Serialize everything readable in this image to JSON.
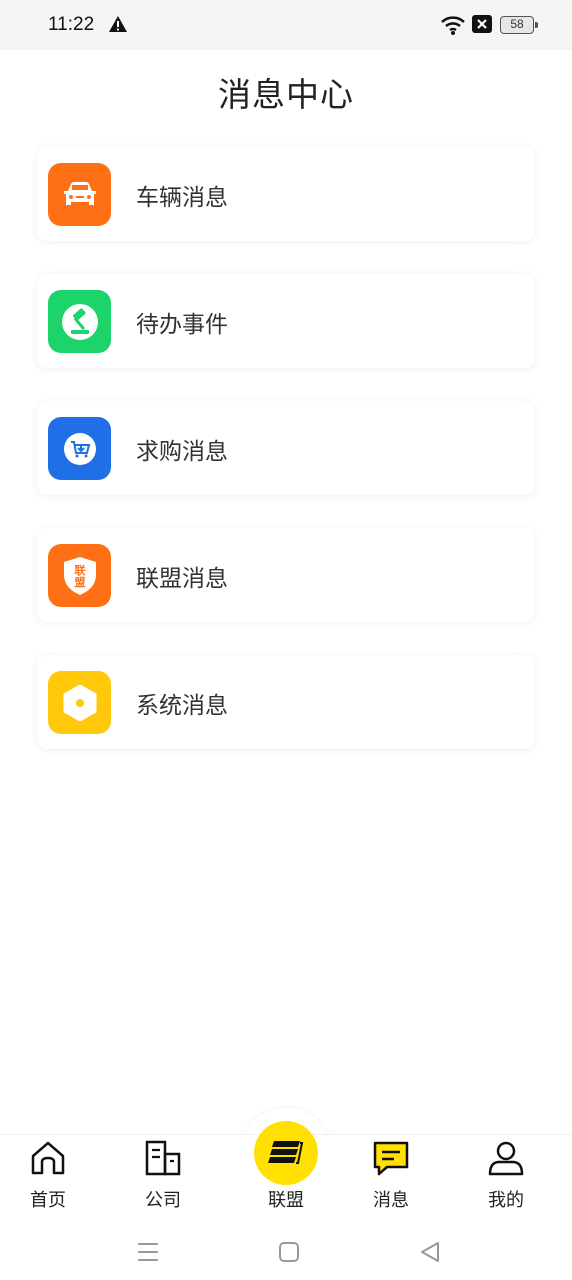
{
  "status": {
    "time": "11:22",
    "battery": "58"
  },
  "page": {
    "title": "消息中心"
  },
  "messages": [
    {
      "label": "车辆消息",
      "icon": "car-icon",
      "color": "#ff7016"
    },
    {
      "label": "待办事件",
      "icon": "gavel-icon",
      "color": "#1cd46a"
    },
    {
      "label": "求购消息",
      "icon": "cart-download-icon",
      "color": "#1f6fe6"
    },
    {
      "label": "联盟消息",
      "icon": "alliance-shield-icon",
      "color": "#ff7016",
      "icon_text": "联盟"
    },
    {
      "label": "系统消息",
      "icon": "hexagon-icon",
      "color": "#ffc80a"
    }
  ],
  "tabs": [
    {
      "label": "首页",
      "icon": "home-icon"
    },
    {
      "label": "公司",
      "icon": "building-icon"
    },
    {
      "label": "联盟",
      "icon": "layers-icon",
      "accent": "#ffe000"
    },
    {
      "label": "消息",
      "icon": "message-icon",
      "selected": true
    },
    {
      "label": "我的",
      "icon": "user-icon"
    }
  ]
}
